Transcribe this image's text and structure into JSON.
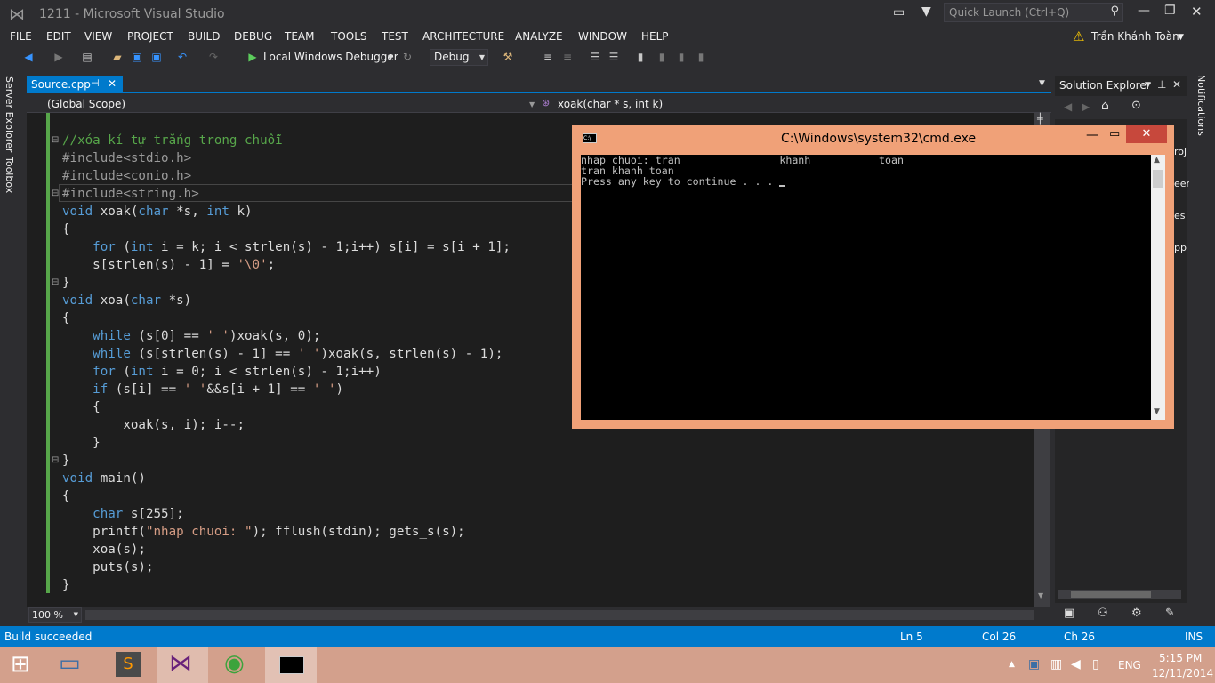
{
  "window": {
    "title": "1211 - Microsoft Visual Studio",
    "quick_launch": "Quick Launch (Ctrl+Q)",
    "user": "Trần Khánh Toàn"
  },
  "menu": [
    "FILE",
    "EDIT",
    "VIEW",
    "PROJECT",
    "BUILD",
    "DEBUG",
    "TEAM",
    "TOOLS",
    "TEST",
    "ARCHITECTURE",
    "ANALYZE",
    "WINDOW",
    "HELP"
  ],
  "toolbar": {
    "debugger": "Local Windows Debugger",
    "config": "Debug"
  },
  "sidebar": {
    "server_explorer": "Server Explorer",
    "toolbox": "Toolbox",
    "notifications": "Notifications"
  },
  "tabs": {
    "active": "Source.cpp"
  },
  "scope": {
    "global": "(Global Scope)",
    "function": "xoak(char * s, int k)"
  },
  "code_lines": [
    "//xóa kí tự trắng trong chuỗi",
    "#include<stdio.h>",
    "#include<conio.h>",
    "#include<string.h>",
    "void xoak(char *s, int k)",
    "{",
    "    for (int i = k; i < strlen(s) - 1;i++) s[i] = s[i + 1];",
    "    s[strlen(s) - 1] = '\\0';",
    "}",
    "void xoa(char *s)",
    "{",
    "    while (s[0] == ' ')xoak(s, 0);",
    "    while (s[strlen(s) - 1] == ' ')xoak(s, strlen(s) - 1);",
    "    for (int i = 0; i < strlen(s) - 1;i++)",
    "    if (s[i] == ' '&&s[i + 1] == ' ')",
    "    {",
    "        xoak(s, i); i--;",
    "    }",
    "}",
    "void main()",
    "{",
    "    char s[255];",
    "    printf(\"nhap chuoi: \"); fflush(stdin); gets_s(s);",
    "    xoa(s);",
    "    puts(s);",
    "}"
  ],
  "zoom": "100 %",
  "cmd": {
    "title": "C:\\Windows\\system32\\cmd.exe",
    "line1": "nhap chuoi: tran                khanh           toan",
    "line2": "tran khanh toan",
    "line3": "Press any key to continue . . . "
  },
  "solution_explorer": {
    "title": "Solution Explorer",
    "fragments": [
      "roj",
      "een",
      "es",
      "pp"
    ]
  },
  "status": {
    "message": "Build succeeded",
    "ln": "Ln 5",
    "col": "Col 26",
    "ch": "Ch 26",
    "mode": "INS"
  },
  "taskbar": {
    "lang": "ENG",
    "time": "5:15 PM",
    "date": "12/11/2014"
  }
}
